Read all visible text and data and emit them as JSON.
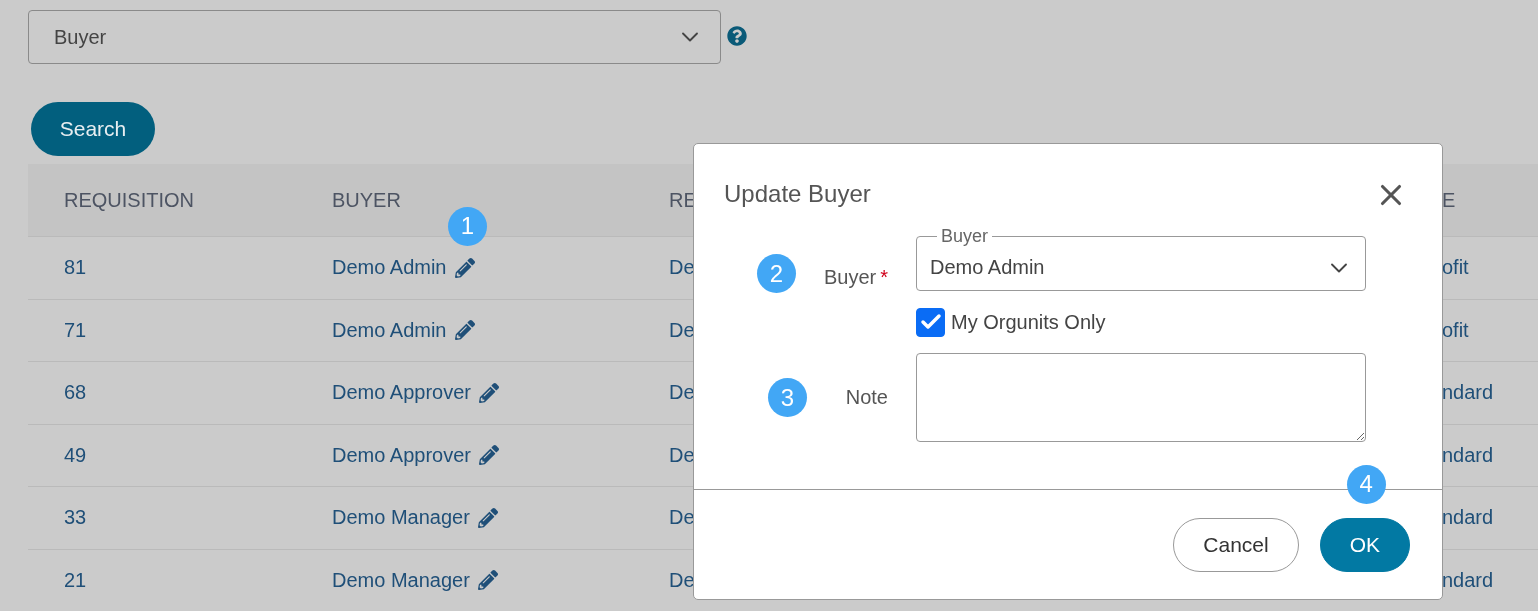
{
  "filter": {
    "value": "Buyer"
  },
  "search_button": "Search",
  "table": {
    "columns": [
      {
        "label": "REQUISITION"
      },
      {
        "label": "BUYER",
        "badge": "1"
      },
      {
        "label": "RE"
      },
      {
        "label": "E"
      }
    ],
    "rows": [
      [
        "81",
        "Demo Admin",
        "De",
        "ofit"
      ],
      [
        "71",
        "Demo Admin",
        "De",
        "ofit"
      ],
      [
        "68",
        "Demo Approver",
        "De",
        "ndard"
      ],
      [
        "49",
        "Demo Approver",
        "De",
        "ndard"
      ],
      [
        "33",
        "Demo Manager",
        "De",
        "ndard"
      ],
      [
        "21",
        "Demo Manager",
        "De",
        "ndard"
      ]
    ]
  },
  "dialog": {
    "title": "Update Buyer",
    "buyer": {
      "label": "Buyer",
      "required_mark": "*",
      "badge": "2",
      "field_label": "Buyer",
      "value": "Demo Admin"
    },
    "orgunits_only": {
      "label": "My Orgunits Only",
      "checked": true
    },
    "note": {
      "label": "Note",
      "badge": "3"
    },
    "buttons": [
      {
        "label": "Cancel",
        "kind": "secondary"
      },
      {
        "label": "OK",
        "kind": "primary",
        "badge": "4"
      }
    ]
  }
}
